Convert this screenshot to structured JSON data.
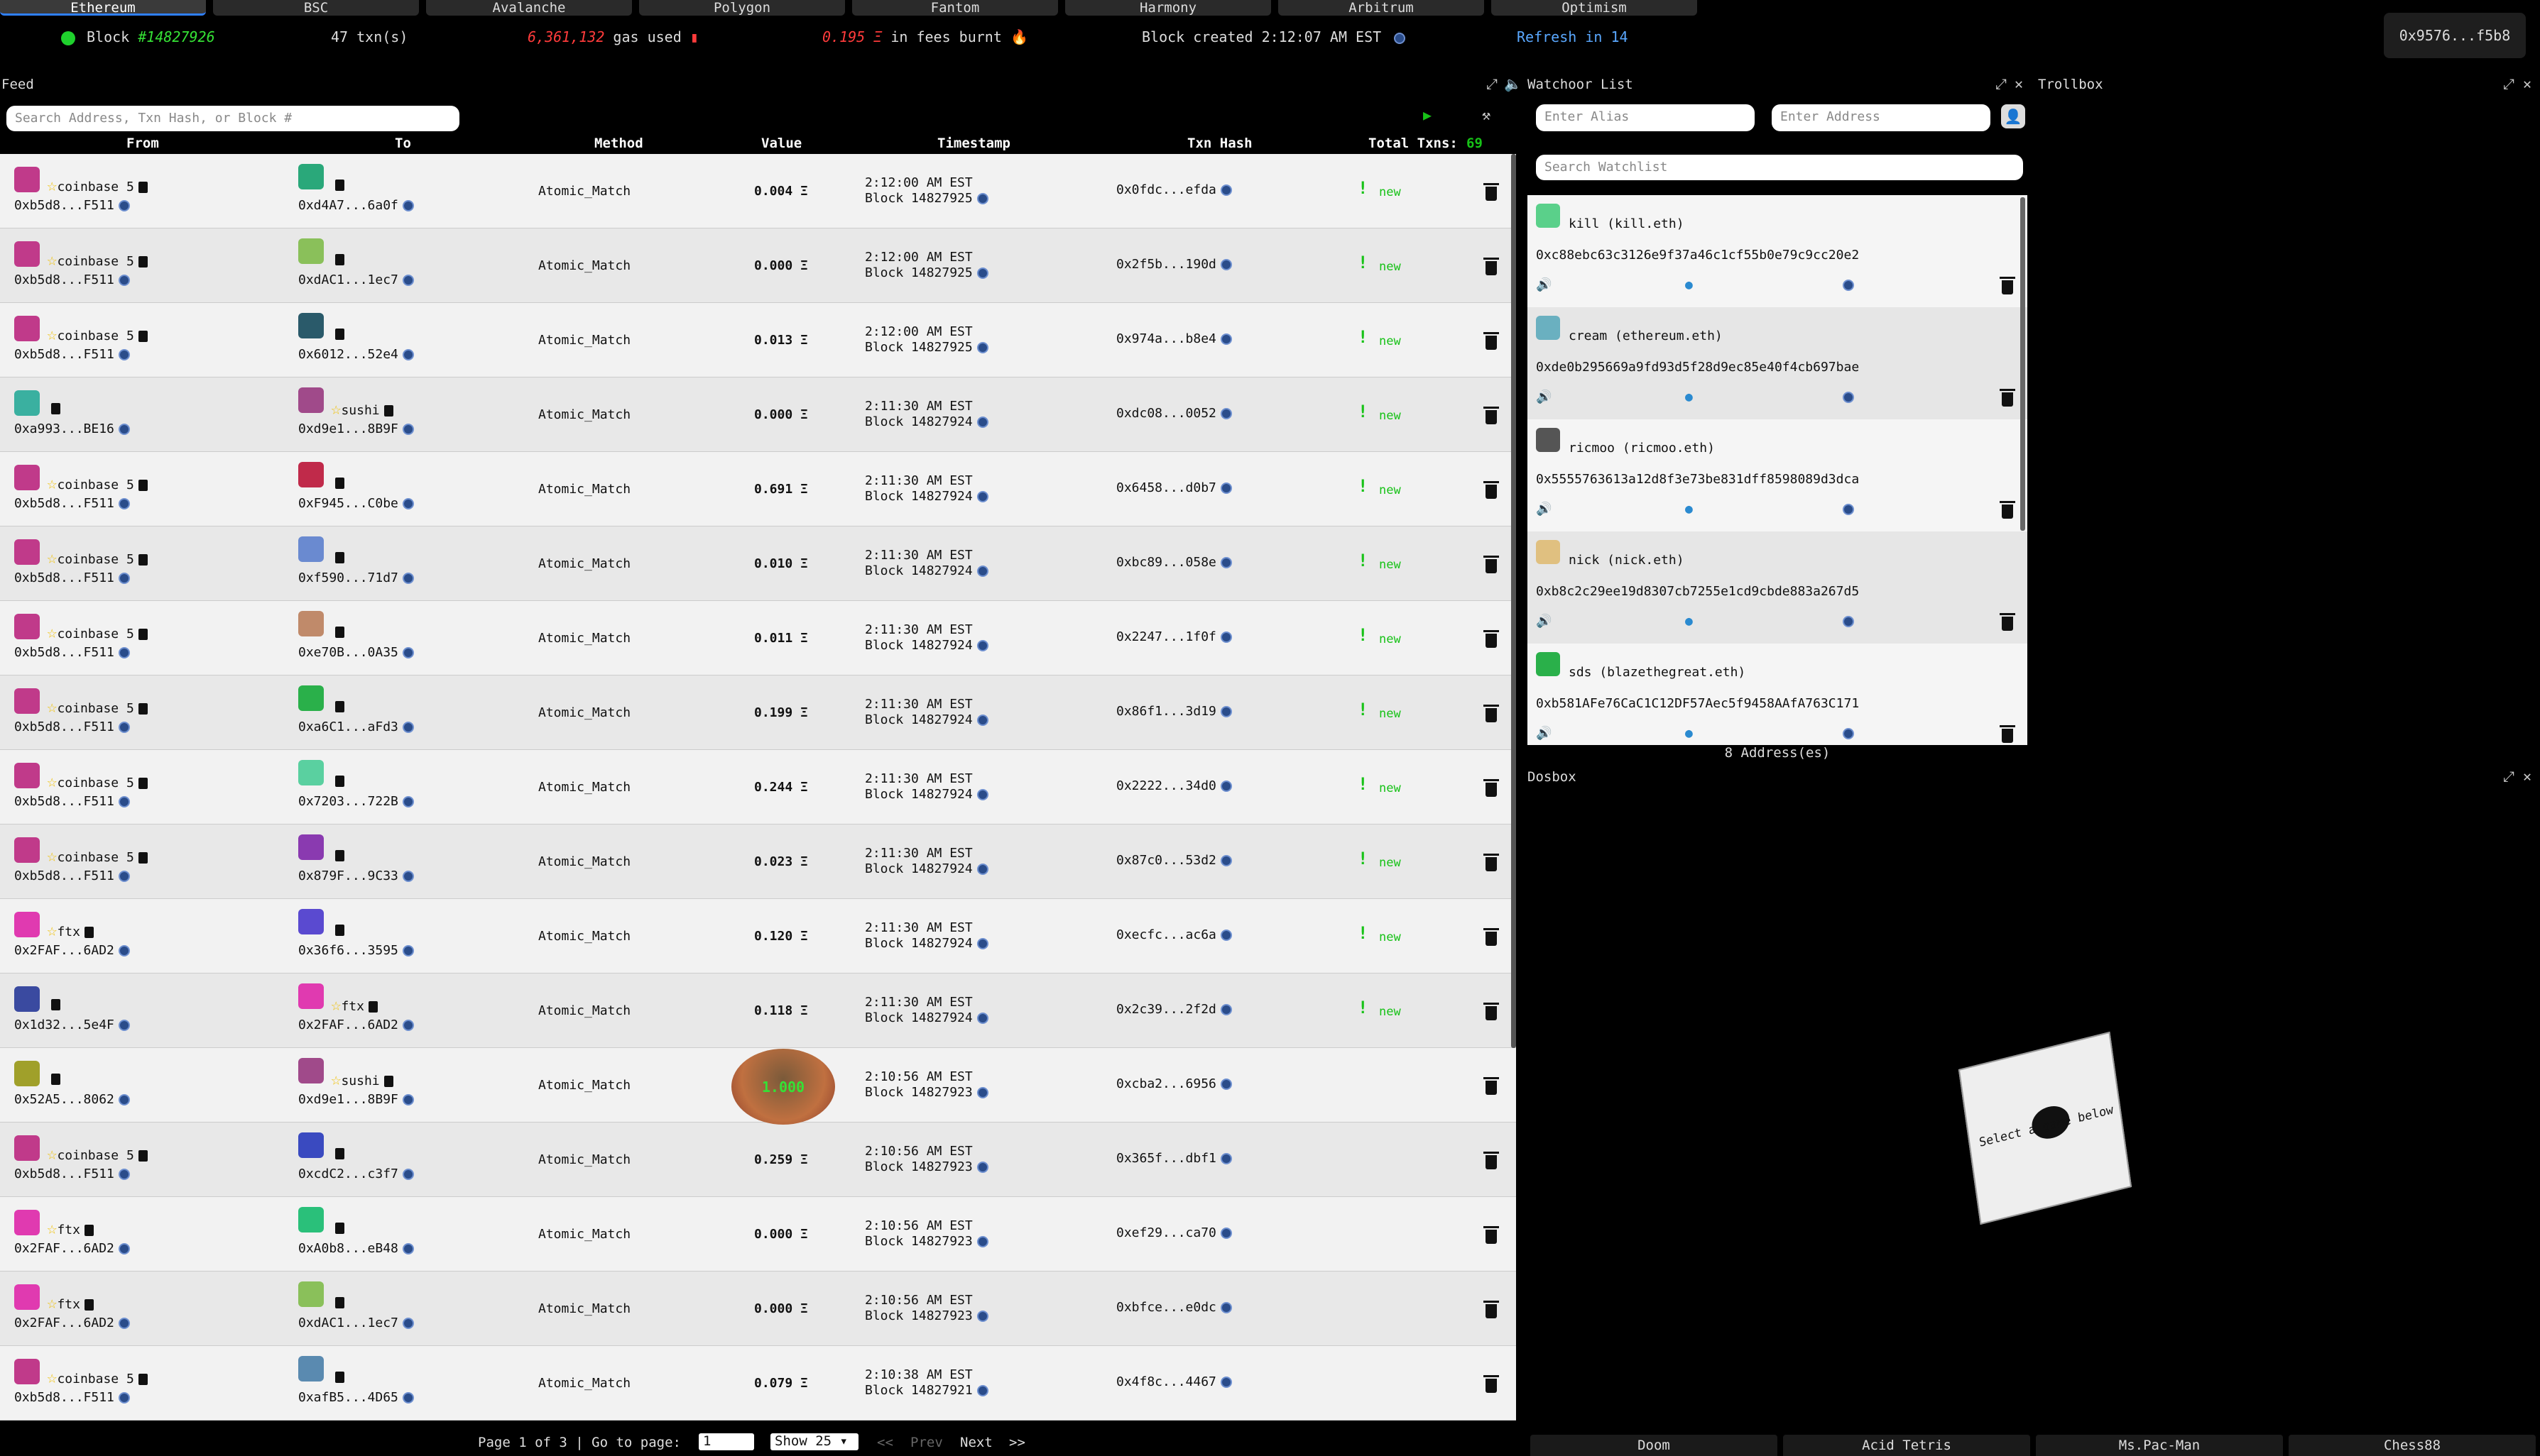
{
  "chains": [
    "Ethereum",
    "BSC",
    "Avalanche",
    "Polygon",
    "Fantom",
    "Harmony",
    "Arbitrum",
    "Optimism"
  ],
  "status": {
    "block_label": "Block",
    "block_number": "#14827926",
    "txns": "47 txn(s)",
    "gas": "6,361,132",
    "gas_label": "gas used",
    "fees": "0.195 Ξ",
    "fees_label": "in fees burnt",
    "created": "Block created 2:12:07 AM EST",
    "refresh": "Refresh in 14",
    "wallet": "0x9576...f5b8"
  },
  "feed": {
    "title": "Feed",
    "search_placeholder": "Search Address, Txn Hash, or Block #",
    "columns": {
      "from": "From",
      "to": "To",
      "method": "Method",
      "value": "Value",
      "timestamp": "Timestamp",
      "hash": "Txn Hash",
      "total": "Total Txns:",
      "total_count": "69"
    },
    "rows": [
      {
        "from_label": "coinbase 5",
        "from_addr": "0xb5d8...F511",
        "to_label": "",
        "to_addr": "0xd4A7...6a0f",
        "method": "Atomic_Match",
        "value": "0.004 Ξ",
        "time": "2:12:00 AM EST",
        "block": "Block 14827925",
        "hash": "0x0fdc...efda",
        "new": "new",
        "fc": "#c03a8a",
        "tc": "#2aa87a"
      },
      {
        "from_label": "coinbase 5",
        "from_addr": "0xb5d8...F511",
        "to_label": "",
        "to_addr": "0xdAC1...1ec7",
        "method": "Atomic_Match",
        "value": "0.000 Ξ",
        "time": "2:12:00 AM EST",
        "block": "Block 14827925",
        "hash": "0x2f5b...190d",
        "new": "new",
        "fc": "#c03a8a",
        "tc": "#8ac05a"
      },
      {
        "from_label": "coinbase 5",
        "from_addr": "0xb5d8...F511",
        "to_label": "",
        "to_addr": "0x6012...52e4",
        "method": "Atomic_Match",
        "value": "0.013 Ξ",
        "time": "2:12:00 AM EST",
        "block": "Block 14827925",
        "hash": "0x974a...b8e4",
        "new": "new",
        "fc": "#c03a8a",
        "tc": "#2a5a6a"
      },
      {
        "from_label": "",
        "from_addr": "0xa993...BE16",
        "to_label": "sushi",
        "to_addr": "0xd9e1...8B9F",
        "method": "Atomic_Match",
        "value": "0.000 Ξ",
        "time": "2:11:30 AM EST",
        "block": "Block 14827924",
        "hash": "0xdc08...0052",
        "new": "new",
        "fc": "#3ab0a0",
        "tc": "#a04a8a"
      },
      {
        "from_label": "coinbase 5",
        "from_addr": "0xb5d8...F511",
        "to_label": "",
        "to_addr": "0xF945...C0be",
        "method": "Atomic_Match",
        "value": "0.691 Ξ",
        "time": "2:11:30 AM EST",
        "block": "Block 14827924",
        "hash": "0x6458...d0b7",
        "new": "new",
        "fc": "#c03a8a",
        "tc": "#c02a4a"
      },
      {
        "from_label": "coinbase 5",
        "from_addr": "0xb5d8...F511",
        "to_label": "",
        "to_addr": "0xf590...71d7",
        "method": "Atomic_Match",
        "value": "0.010 Ξ",
        "time": "2:11:30 AM EST",
        "block": "Block 14827924",
        "hash": "0xbc89...058e",
        "new": "new",
        "fc": "#c03a8a",
        "tc": "#6a8ad0"
      },
      {
        "from_label": "coinbase 5",
        "from_addr": "0xb5d8...F511",
        "to_label": "",
        "to_addr": "0xe70B...0A35",
        "method": "Atomic_Match",
        "value": "0.011 Ξ",
        "time": "2:11:30 AM EST",
        "block": "Block 14827924",
        "hash": "0x2247...1f0f",
        "new": "new",
        "fc": "#c03a8a",
        "tc": "#c08a6a"
      },
      {
        "from_label": "coinbase 5",
        "from_addr": "0xb5d8...F511",
        "to_label": "",
        "to_addr": "0xa6C1...aFd3",
        "method": "Atomic_Match",
        "value": "0.199 Ξ",
        "time": "2:11:30 AM EST",
        "block": "Block 14827924",
        "hash": "0x86f1...3d19",
        "new": "new",
        "fc": "#c03a8a",
        "tc": "#2ab04a"
      },
      {
        "from_label": "coinbase 5",
        "from_addr": "0xb5d8...F511",
        "to_label": "",
        "to_addr": "0x7203...722B",
        "method": "Atomic_Match",
        "value": "0.244 Ξ",
        "time": "2:11:30 AM EST",
        "block": "Block 14827924",
        "hash": "0x2222...34d0",
        "new": "new",
        "fc": "#c03a8a",
        "tc": "#5ad0a0"
      },
      {
        "from_label": "coinbase 5",
        "from_addr": "0xb5d8...F511",
        "to_label": "",
        "to_addr": "0x879F...9C33",
        "method": "Atomic_Match",
        "value": "0.023 Ξ",
        "time": "2:11:30 AM EST",
        "block": "Block 14827924",
        "hash": "0x87c0...53d2",
        "new": "new",
        "fc": "#c03a8a",
        "tc": "#8a3ab0"
      },
      {
        "from_label": "ftx",
        "from_addr": "0x2FAF...6AD2",
        "to_label": "",
        "to_addr": "0x36f6...3595",
        "method": "Atomic_Match",
        "value": "0.120 Ξ",
        "time": "2:11:30 AM EST",
        "block": "Block 14827924",
        "hash": "0xecfc...ac6a",
        "new": "new",
        "fc": "#e03ab0",
        "tc": "#5a4ad0"
      },
      {
        "from_label": "",
        "from_addr": "0x1d32...5e4F",
        "to_label": "ftx",
        "to_addr": "0x2FAF...6AD2",
        "method": "Atomic_Match",
        "value": "0.118 Ξ",
        "time": "2:11:30 AM EST",
        "block": "Block 14827924",
        "hash": "0x2c39...2f2d",
        "new": "new",
        "fc": "#3a4aa0",
        "tc": "#e03ab0"
      },
      {
        "from_label": "",
        "from_addr": "0x52A5...8062",
        "to_label": "sushi",
        "to_addr": "0xd9e1...8B9F",
        "method": "Atomic_Match",
        "value": "",
        "time": "2:10:56 AM EST",
        "block": "Block 14827923",
        "hash": "0xcba2...6956",
        "new": "",
        "fc": "#a0a02a",
        "tc": "#a04a8a"
      },
      {
        "from_label": "coinbase 5",
        "from_addr": "0xb5d8...F511",
        "to_label": "",
        "to_addr": "0xcdC2...c3f7",
        "method": "Atomic_Match",
        "value": "0.259 Ξ",
        "time": "2:10:56 AM EST",
        "block": "Block 14827923",
        "hash": "0x365f...dbf1",
        "new": "",
        "fc": "#c03a8a",
        "tc": "#3a4ac0"
      },
      {
        "from_label": "ftx",
        "from_addr": "0x2FAF...6AD2",
        "to_label": "",
        "to_addr": "0xA0b8...eB48",
        "method": "Atomic_Match",
        "value": "0.000 Ξ",
        "time": "2:10:56 AM EST",
        "block": "Block 14827923",
        "hash": "0xef29...ca70",
        "new": "",
        "fc": "#e03ab0",
        "tc": "#2ac07a"
      },
      {
        "from_label": "ftx",
        "from_addr": "0x2FAF...6AD2",
        "to_label": "",
        "to_addr": "0xdAC1...1ec7",
        "method": "Atomic_Match",
        "value": "0.000 Ξ",
        "time": "2:10:56 AM EST",
        "block": "Block 14827923",
        "hash": "0xbfce...e0dc",
        "new": "",
        "fc": "#e03ab0",
        "tc": "#8ac05a"
      },
      {
        "from_label": "coinbase 5",
        "from_addr": "0xb5d8...F511",
        "to_label": "",
        "to_addr": "0xafB5...4D65",
        "method": "Atomic_Match",
        "value": "0.079 Ξ",
        "time": "2:10:38 AM EST",
        "block": "Block 14827921",
        "hash": "0x4f8c...4467",
        "new": "",
        "fc": "#c03a8a",
        "tc": "#5a8ab0"
      }
    ],
    "pager": {
      "page": "Page 1 of 3 | Go to page:",
      "goto": "1",
      "show": "Show 25",
      "first": "<<",
      "prev": "Prev",
      "next": "Next",
      "last": ">>"
    }
  },
  "watch": {
    "title": "Watchoor List",
    "alias_placeholder": "Enter Alias",
    "address_placeholder": "Enter Address",
    "search_placeholder": "Search Watchlist",
    "count": "8 Address(es)",
    "items": [
      {
        "name": "kill (kill.eth)",
        "addr": "0xc88ebc63c3126e9f37a46c1cf55b0e79c9cc20e2",
        "c": "#5ad08a"
      },
      {
        "name": "cream (ethereum.eth)",
        "addr": "0xde0b295669a9fd93d5f28d9ec85e40f4cb697bae",
        "c": "#6ab0c0"
      },
      {
        "name": "ricmoo (ricmoo.eth)",
        "addr": "0x5555763613a12d8f3e73be831dff8598089d3dca",
        "c": "#555"
      },
      {
        "name": "nick (nick.eth)",
        "addr": "0xb8c2c29ee19d8307cb7255e1cd9cbde883a267d5",
        "c": "#e0c080"
      },
      {
        "name": "sds (blazethegreat.eth)",
        "addr": "0xb581AFe76CaC1C12DF57Aec5f9458AAfA763C171",
        "c": "#2ab04a"
      }
    ]
  },
  "trollbox": {
    "title": "Trollbox"
  },
  "dosbox": {
    "title": "Dosbox",
    "caption": "Select a game below",
    "games": [
      "Doom",
      "Acid Tetris",
      "Ms.Pac-Man",
      "Chess88"
    ]
  },
  "popup_value": "1.000"
}
